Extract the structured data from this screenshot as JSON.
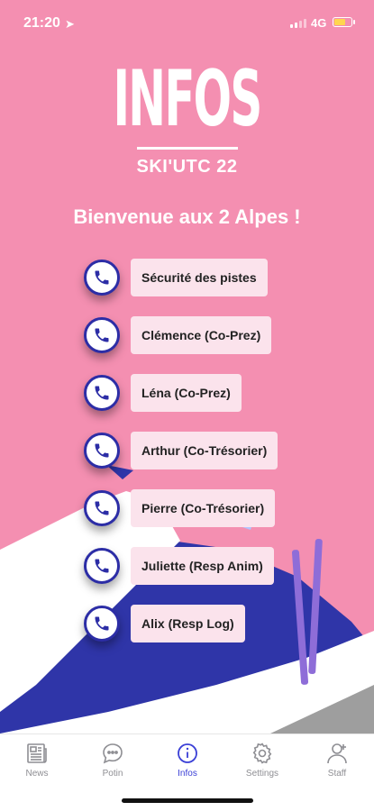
{
  "status_bar": {
    "time": "21:20",
    "network": "4G"
  },
  "logo": {
    "title": "INFOS",
    "subtitle": "SKI'UTC 22"
  },
  "welcome": "Bienvenue aux 2 Alpes !",
  "contacts": [
    {
      "label": "Sécurité des pistes"
    },
    {
      "label": "Clémence (Co-Prez)"
    },
    {
      "label": "Léna (Co-Prez)"
    },
    {
      "label": "Arthur (Co-Trésorier)"
    },
    {
      "label": "Pierre (Co-Trésorier)"
    },
    {
      "label": "Juliette (Resp Anim)"
    },
    {
      "label": "Alix (Resp Log)"
    }
  ],
  "tabs": [
    {
      "label": "News",
      "icon": "newspaper-icon"
    },
    {
      "label": "Potin",
      "icon": "chat-bubble-icon"
    },
    {
      "label": "Infos",
      "icon": "info-icon",
      "active": true
    },
    {
      "label": "Settings",
      "icon": "gear-icon"
    },
    {
      "label": "Staff",
      "icon": "add-person-icon"
    }
  ],
  "colors": {
    "background": "#f48fb1",
    "accent": "#2c2da6",
    "active_tab": "#3a3fd6",
    "label_bg": "#fbe3ec"
  }
}
